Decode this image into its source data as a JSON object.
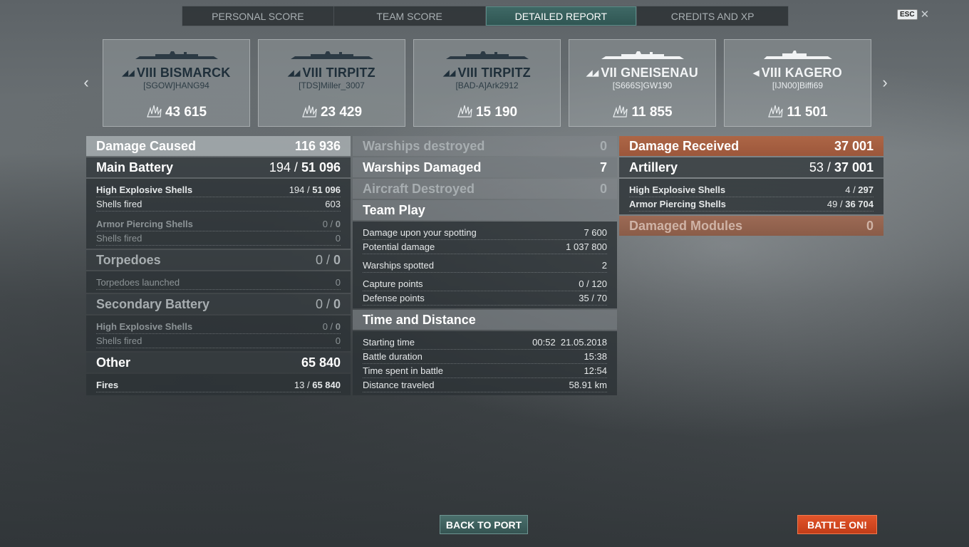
{
  "tabs": [
    {
      "label": "PERSONAL SCORE",
      "active": false
    },
    {
      "label": "TEAM SCORE",
      "active": false
    },
    {
      "label": "DETAILED REPORT",
      "active": true
    },
    {
      "label": "CREDITS AND XP",
      "active": false
    }
  ],
  "esc": {
    "key": "ESC",
    "close": "✕"
  },
  "ships": [
    {
      "tier": "VIII",
      "name": "BISMARCK",
      "player": "[SGOW]HANG94",
      "damage": "43 615",
      "class_icon": "battleship-icon"
    },
    {
      "tier": "VIII",
      "name": "TIRPITZ",
      "player": "[TDS]Miller_3007",
      "damage": "23 429",
      "class_icon": "battleship-icon"
    },
    {
      "tier": "VIII",
      "name": "TIRPITZ",
      "player": "[BAD-A]Ark2912",
      "damage": "15 190",
      "class_icon": "battleship-icon"
    },
    {
      "tier": "VII",
      "name": "GNEISENAU",
      "player": "[S666S]GW190",
      "damage": "11 855",
      "class_icon": "battleship-icon"
    },
    {
      "tier": "VIII",
      "name": "KAGERO",
      "player": "[IJN00]Biffi69",
      "damage": "11 501",
      "class_icon": "destroyer-icon"
    }
  ],
  "col1": {
    "damage_caused": {
      "label": "Damage Caused",
      "value": "116 936"
    },
    "main_battery": {
      "label": "Main Battery",
      "hits": "194",
      "sep": " / ",
      "dmg": "51 096"
    },
    "mb_he": {
      "label": "High Explosive Shells",
      "hits": "194",
      "sep": " / ",
      "dmg": "51 096"
    },
    "mb_he_fired": {
      "label": "Shells fired",
      "value": "603"
    },
    "mb_ap": {
      "label": "Armor Piercing Shells",
      "hits": "0",
      "sep": " / ",
      "dmg": "0"
    },
    "mb_ap_fired": {
      "label": "Shells fired",
      "value": "0"
    },
    "torpedoes": {
      "label": "Torpedoes",
      "hits": "0",
      "sep": " / ",
      "dmg": "0"
    },
    "torp_launched": {
      "label": "Torpedoes launched",
      "value": "0"
    },
    "secondary": {
      "label": "Secondary Battery",
      "hits": "0",
      "sep": " / ",
      "dmg": "0"
    },
    "sec_he": {
      "label": "High Explosive Shells",
      "hits": "0",
      "sep": " / ",
      "dmg": "0"
    },
    "sec_fired": {
      "label": "Shells fired",
      "value": "0"
    },
    "other": {
      "label": "Other",
      "value": "65 840"
    },
    "fires": {
      "label": "Fires",
      "hits": "13",
      "sep": " / ",
      "dmg": "65 840"
    }
  },
  "col2": {
    "warships_destroyed": {
      "label": "Warships destroyed",
      "value": "0"
    },
    "warships_damaged": {
      "label": "Warships Damaged",
      "value": "7"
    },
    "aircraft_destroyed": {
      "label": "Aircraft Destroyed",
      "value": "0"
    },
    "team_play": {
      "label": "Team Play"
    },
    "spotting_damage": {
      "label": "Damage upon your spotting",
      "value": "7 600"
    },
    "potential_damage": {
      "label": "Potential damage",
      "value": "1 037 800"
    },
    "warships_spotted": {
      "label": "Warships spotted",
      "value": "2"
    },
    "capture_points": {
      "label": "Capture points",
      "value": "0 / 120"
    },
    "defense_points": {
      "label": "Defense points",
      "value": "35 / 70"
    },
    "time_distance": {
      "label": "Time and Distance"
    },
    "starting_time": {
      "label": "Starting time",
      "value": "00:52  21.05.2018"
    },
    "battle_duration": {
      "label": "Battle duration",
      "value": "15:38"
    },
    "time_in_battle": {
      "label": "Time spent in battle",
      "value": "12:54"
    },
    "distance": {
      "label": "Distance traveled",
      "value": "58.91 km"
    }
  },
  "col3": {
    "damage_received": {
      "label": "Damage Received",
      "value": "37 001"
    },
    "artillery": {
      "label": "Artillery",
      "hits": "53",
      "sep": " / ",
      "dmg": "37 001"
    },
    "he": {
      "label": "High Explosive Shells",
      "hits": "4",
      "sep": " / ",
      "dmg": "297"
    },
    "ap": {
      "label": "Armor Piercing Shells",
      "hits": "49",
      "sep": " / ",
      "dmg": "36 704"
    },
    "damaged_modules": {
      "label": "Damaged Modules",
      "value": "0"
    }
  },
  "buttons": {
    "back": "BACK TO PORT",
    "battle": "BATTLE ON!"
  },
  "colors": {
    "accent_teal": "#3f6966",
    "accent_orange": "#ad6646",
    "battle_button": "#e2542a"
  }
}
